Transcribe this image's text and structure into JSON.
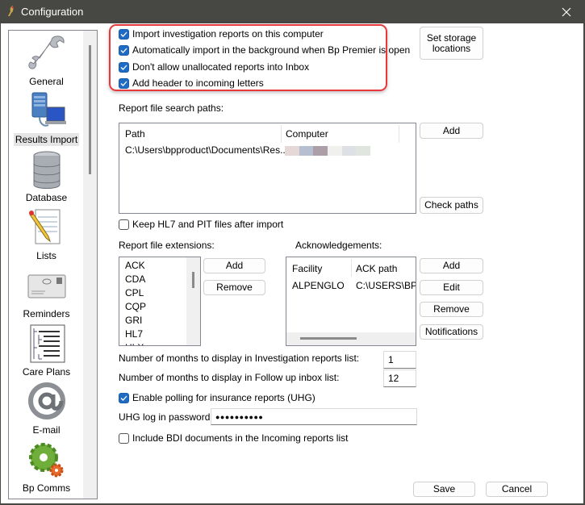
{
  "window": {
    "title": "Configuration",
    "app_icon": "bird-icon",
    "close_icon": "close-icon"
  },
  "sidebar": {
    "items": [
      {
        "label": "General",
        "icon": "wrench-icon",
        "selected": false
      },
      {
        "label": "Results Import",
        "icon": "server-computer-icon",
        "selected": true
      },
      {
        "label": "Database",
        "icon": "database-icon",
        "selected": false
      },
      {
        "label": "Lists",
        "icon": "notepad-pencil-icon",
        "selected": false
      },
      {
        "label": "Reminders",
        "icon": "envelope-icon",
        "selected": false
      },
      {
        "label": "Care Plans",
        "icon": "tree-document-icon",
        "selected": false
      },
      {
        "label": "E-mail",
        "icon": "at-sign-icon",
        "selected": false
      },
      {
        "label": "Bp Comms",
        "icon": "gears-icon",
        "selected": false
      }
    ]
  },
  "options": {
    "import_reports": {
      "label": "Import investigation reports on this computer",
      "checked": true
    },
    "auto_import": {
      "label": "Automatically import in the background when Bp Premier is open",
      "checked": true
    },
    "no_unallocated": {
      "label": "Don't allow unallocated reports into Inbox",
      "checked": true
    },
    "add_header": {
      "label": "Add header to incoming letters",
      "checked": true
    },
    "keep_files": {
      "label": "Keep HL7 and PIT files after import",
      "checked": false
    },
    "enable_polling": {
      "label": "Enable polling for insurance reports (UHG)",
      "checked": true
    },
    "include_bdi": {
      "label": "Include BDI documents in the Incoming reports list",
      "checked": false
    }
  },
  "buttons": {
    "set_storage": "Set storage locations",
    "paths_add": "Add",
    "check_paths": "Check paths",
    "ext_add": "Add",
    "ext_remove": "Remove",
    "ack_add": "Add",
    "ack_edit": "Edit",
    "ack_remove": "Remove",
    "notifications": "Notifications",
    "save": "Save",
    "cancel": "Cancel"
  },
  "search_paths": {
    "label": "Report file search paths:",
    "columns": [
      "Path",
      "Computer"
    ],
    "rows": [
      {
        "path": "C:\\Users\\bpproduct\\Documents\\Res...",
        "computer": "(redacted)"
      }
    ]
  },
  "extensions": {
    "label": "Report file extensions:",
    "items": [
      "ACK",
      "CDA",
      "CPL",
      "CQP",
      "GRI",
      "HL7",
      "HLX"
    ]
  },
  "acknowledgements": {
    "label": "Acknowledgements:",
    "columns": [
      "Facility",
      "ACK path"
    ],
    "rows": [
      {
        "facility": "ALPENGLO",
        "ack_path": "C:\\USERS\\BP"
      }
    ]
  },
  "fields": {
    "months_investigation": {
      "label": "Number of months to display in Investigation reports list:",
      "value": "1"
    },
    "months_followup": {
      "label": "Number of months to display in Follow up inbox list:",
      "value": "12"
    },
    "uhg_password": {
      "label": "UHG log in password:",
      "value": "●●●●●●●●●●"
    }
  },
  "colors": {
    "accent": "#1f6bc4",
    "highlight": "#e8383d",
    "titlebar": "#474744"
  }
}
